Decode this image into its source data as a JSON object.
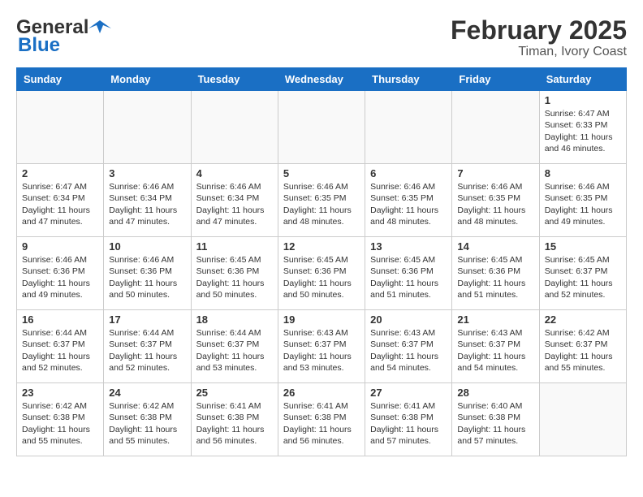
{
  "logo": {
    "text_general": "General",
    "text_blue": "Blue"
  },
  "title": "February 2025",
  "subtitle": "Timan, Ivory Coast",
  "days_of_week": [
    "Sunday",
    "Monday",
    "Tuesday",
    "Wednesday",
    "Thursday",
    "Friday",
    "Saturday"
  ],
  "weeks": [
    [
      {
        "day": "",
        "info": ""
      },
      {
        "day": "",
        "info": ""
      },
      {
        "day": "",
        "info": ""
      },
      {
        "day": "",
        "info": ""
      },
      {
        "day": "",
        "info": ""
      },
      {
        "day": "",
        "info": ""
      },
      {
        "day": "1",
        "info": "Sunrise: 6:47 AM\nSunset: 6:33 PM\nDaylight: 11 hours and 46 minutes."
      }
    ],
    [
      {
        "day": "2",
        "info": "Sunrise: 6:47 AM\nSunset: 6:34 PM\nDaylight: 11 hours and 47 minutes."
      },
      {
        "day": "3",
        "info": "Sunrise: 6:46 AM\nSunset: 6:34 PM\nDaylight: 11 hours and 47 minutes."
      },
      {
        "day": "4",
        "info": "Sunrise: 6:46 AM\nSunset: 6:34 PM\nDaylight: 11 hours and 47 minutes."
      },
      {
        "day": "5",
        "info": "Sunrise: 6:46 AM\nSunset: 6:35 PM\nDaylight: 11 hours and 48 minutes."
      },
      {
        "day": "6",
        "info": "Sunrise: 6:46 AM\nSunset: 6:35 PM\nDaylight: 11 hours and 48 minutes."
      },
      {
        "day": "7",
        "info": "Sunrise: 6:46 AM\nSunset: 6:35 PM\nDaylight: 11 hours and 48 minutes."
      },
      {
        "day": "8",
        "info": "Sunrise: 6:46 AM\nSunset: 6:35 PM\nDaylight: 11 hours and 49 minutes."
      }
    ],
    [
      {
        "day": "9",
        "info": "Sunrise: 6:46 AM\nSunset: 6:36 PM\nDaylight: 11 hours and 49 minutes."
      },
      {
        "day": "10",
        "info": "Sunrise: 6:46 AM\nSunset: 6:36 PM\nDaylight: 11 hours and 50 minutes."
      },
      {
        "day": "11",
        "info": "Sunrise: 6:45 AM\nSunset: 6:36 PM\nDaylight: 11 hours and 50 minutes."
      },
      {
        "day": "12",
        "info": "Sunrise: 6:45 AM\nSunset: 6:36 PM\nDaylight: 11 hours and 50 minutes."
      },
      {
        "day": "13",
        "info": "Sunrise: 6:45 AM\nSunset: 6:36 PM\nDaylight: 11 hours and 51 minutes."
      },
      {
        "day": "14",
        "info": "Sunrise: 6:45 AM\nSunset: 6:36 PM\nDaylight: 11 hours and 51 minutes."
      },
      {
        "day": "15",
        "info": "Sunrise: 6:45 AM\nSunset: 6:37 PM\nDaylight: 11 hours and 52 minutes."
      }
    ],
    [
      {
        "day": "16",
        "info": "Sunrise: 6:44 AM\nSunset: 6:37 PM\nDaylight: 11 hours and 52 minutes."
      },
      {
        "day": "17",
        "info": "Sunrise: 6:44 AM\nSunset: 6:37 PM\nDaylight: 11 hours and 52 minutes."
      },
      {
        "day": "18",
        "info": "Sunrise: 6:44 AM\nSunset: 6:37 PM\nDaylight: 11 hours and 53 minutes."
      },
      {
        "day": "19",
        "info": "Sunrise: 6:43 AM\nSunset: 6:37 PM\nDaylight: 11 hours and 53 minutes."
      },
      {
        "day": "20",
        "info": "Sunrise: 6:43 AM\nSunset: 6:37 PM\nDaylight: 11 hours and 54 minutes."
      },
      {
        "day": "21",
        "info": "Sunrise: 6:43 AM\nSunset: 6:37 PM\nDaylight: 11 hours and 54 minutes."
      },
      {
        "day": "22",
        "info": "Sunrise: 6:42 AM\nSunset: 6:37 PM\nDaylight: 11 hours and 55 minutes."
      }
    ],
    [
      {
        "day": "23",
        "info": "Sunrise: 6:42 AM\nSunset: 6:38 PM\nDaylight: 11 hours and 55 minutes."
      },
      {
        "day": "24",
        "info": "Sunrise: 6:42 AM\nSunset: 6:38 PM\nDaylight: 11 hours and 55 minutes."
      },
      {
        "day": "25",
        "info": "Sunrise: 6:41 AM\nSunset: 6:38 PM\nDaylight: 11 hours and 56 minutes."
      },
      {
        "day": "26",
        "info": "Sunrise: 6:41 AM\nSunset: 6:38 PM\nDaylight: 11 hours and 56 minutes."
      },
      {
        "day": "27",
        "info": "Sunrise: 6:41 AM\nSunset: 6:38 PM\nDaylight: 11 hours and 57 minutes."
      },
      {
        "day": "28",
        "info": "Sunrise: 6:40 AM\nSunset: 6:38 PM\nDaylight: 11 hours and 57 minutes."
      },
      {
        "day": "",
        "info": ""
      }
    ]
  ]
}
